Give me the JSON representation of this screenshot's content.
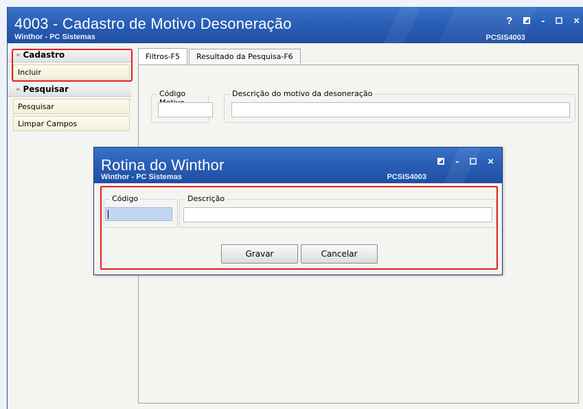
{
  "window": {
    "title": "4003 - Cadastro de Motivo Desoneração",
    "subtitle": "Winthor - PC Sistemas",
    "code": "PCSIS4003",
    "controls": [
      "help-icon",
      "restore-icon",
      "minimize-icon",
      "maximize-icon",
      "close-icon"
    ],
    "help_glyph": "?",
    "minimize_glyph": "-",
    "close_glyph": "×"
  },
  "sidebar": {
    "sections": [
      {
        "label": "Cadastro",
        "items": [
          "Incluir"
        ]
      },
      {
        "label": "Pesquisar",
        "items": [
          "Pesquisar",
          "Limpar Campos"
        ]
      }
    ]
  },
  "tabs": [
    {
      "label": "Filtros-F5",
      "active": true
    },
    {
      "label": "Resultado da Pesquisa-F6",
      "active": false
    }
  ],
  "filters": {
    "codigo_label": "Código Motivo",
    "codigo_value": "",
    "descricao_label": "Descrição do motivo da desoneração",
    "descricao_value": ""
  },
  "dialog": {
    "title": "Rotina do Winthor",
    "subtitle": "Winthor - PC Sistemas",
    "code": "PCSIS4003",
    "codigo_label": "Código",
    "codigo_value": "",
    "descricao_label": "Descrição",
    "descricao_value": "",
    "save_label": "Gravar",
    "cancel_label": "Cancelar",
    "minimize_glyph": "-",
    "close_glyph": "×"
  },
  "colors": {
    "titlebar": "#2a5fb6",
    "highlight": "#e02020",
    "sidebar_item_bg": "#f8f5e2"
  }
}
